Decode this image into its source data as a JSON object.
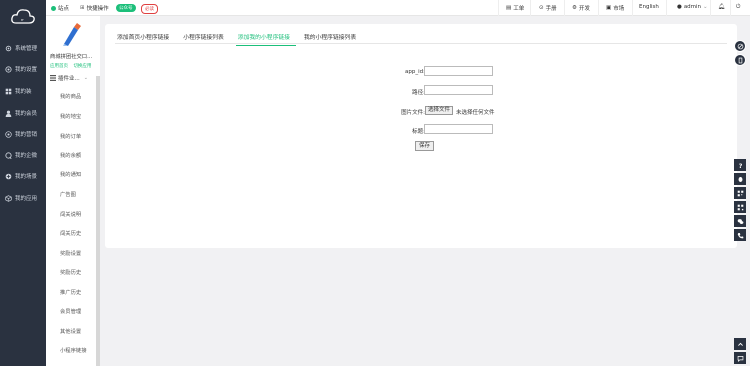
{
  "sidebar": {
    "items": [
      {
        "label": "系统管理",
        "icon": "gear-icon"
      },
      {
        "label": "我的设置",
        "icon": "settings-icon"
      },
      {
        "label": "我的装",
        "icon": "grid-icon"
      },
      {
        "label": "我的会员",
        "icon": "user-icon"
      },
      {
        "label": "我的营销",
        "icon": "target-icon"
      },
      {
        "label": "我的企微",
        "icon": "chat-icon"
      },
      {
        "label": "我的场景",
        "icon": "scene-icon"
      },
      {
        "label": "我的应用",
        "icon": "cube-icon"
      }
    ]
  },
  "subnav": {
    "app_name": "商城拼团社交口...",
    "links": [
      "应用首页",
      "切换应用"
    ],
    "group_title": "插件业...",
    "items": [
      "我的商品",
      "我的地宝",
      "我的订单",
      "我的余额",
      "我的通知",
      "广告图",
      "闯关说明",
      "闯关历史",
      "奖励设置",
      "奖励历史",
      "推广历史",
      "会员管理",
      "其他设置",
      "小程序链接"
    ]
  },
  "topbar": {
    "site_label": "站点",
    "quick_label": "快捷操作",
    "badge_green": "公众号",
    "badge_red": "必读",
    "menu": [
      "工单",
      "手册",
      "开发",
      "市场"
    ],
    "language": "English",
    "user": "admin"
  },
  "tabs": {
    "items": [
      "添加首页小程序链接",
      "小程序链接列表",
      "添加我的小程序链接",
      "我的小程序链接列表"
    ],
    "active_index": 2
  },
  "form": {
    "app_id_label": "app_id:",
    "path_label": "路径:",
    "image_label": "图片文件:",
    "file_button": "选择文件",
    "file_note": "未选择任何文件",
    "title_label": "标题:",
    "save_label": "保存"
  },
  "colors": {
    "accent": "#1cbf7a",
    "sidebar": "#2a3240",
    "danger": "#e04040"
  }
}
